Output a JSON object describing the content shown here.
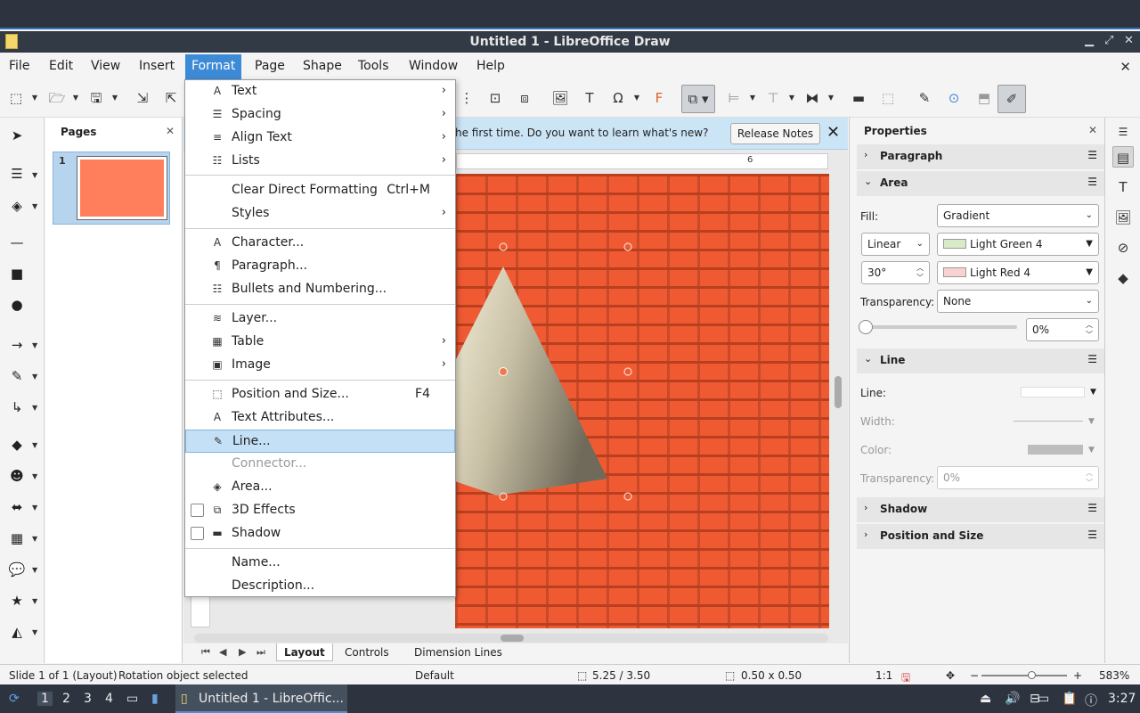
{
  "window": {
    "title": "Untitled 1 - LibreOffice Draw"
  },
  "menubar": {
    "items": [
      "File",
      "Edit",
      "View",
      "Insert",
      "Format",
      "Page",
      "Shape",
      "Tools",
      "Window",
      "Help"
    ],
    "active": "Format"
  },
  "format_menu": {
    "items": [
      {
        "label": "Text",
        "icon": "text-icon",
        "submenu": true
      },
      {
        "label": "Spacing",
        "icon": "spacing-icon",
        "submenu": true
      },
      {
        "label": "Align Text",
        "icon": "align-icon",
        "submenu": true
      },
      {
        "label": "Lists",
        "icon": "list-icon",
        "submenu": true
      },
      {
        "label": "Clear Direct Formatting",
        "shortcut": "Ctrl+M"
      },
      {
        "label": "Styles",
        "submenu": true
      },
      {
        "label": "Character...",
        "icon": "character-icon"
      },
      {
        "label": "Paragraph...",
        "icon": "paragraph-icon"
      },
      {
        "label": "Bullets and Numbering...",
        "icon": "bullets-icon"
      },
      {
        "label": "Layer...",
        "icon": "layer-icon"
      },
      {
        "label": "Table",
        "icon": "table-icon",
        "submenu": true
      },
      {
        "label": "Image",
        "icon": "image-icon",
        "submenu": true
      },
      {
        "label": "Position and Size...",
        "icon": "position-size-icon",
        "shortcut": "F4"
      },
      {
        "label": "Text Attributes...",
        "icon": "text-attributes-icon"
      },
      {
        "label": "Line...",
        "icon": "line-icon",
        "highlighted": true
      },
      {
        "label": "Connector...",
        "icon": "connector-icon",
        "disabled": true
      },
      {
        "label": "Area...",
        "icon": "area-icon"
      },
      {
        "label": "3D Effects",
        "icon": "3d-effects-icon",
        "checkbox": true
      },
      {
        "label": "Shadow",
        "icon": "shadow-icon",
        "checkbox": true
      },
      {
        "label": "Name..."
      },
      {
        "label": "Description..."
      }
    ]
  },
  "pages_panel": {
    "title": "Pages",
    "page_number": "1"
  },
  "infobar": {
    "message": "he first time. Do you want to learn what's new?",
    "button": "Release Notes"
  },
  "ruler": {
    "label": "6"
  },
  "tabs": {
    "items": [
      "Layout",
      "Controls",
      "Dimension Lines"
    ],
    "active": "Layout"
  },
  "sidebar": {
    "title": "Properties",
    "paragraph": "Paragraph",
    "area": "Area",
    "fill_label": "Fill:",
    "fill_value": "Gradient",
    "gradient_type": "Linear",
    "color_from": "Light Green 4",
    "color_from_hex": "#d7ebc9",
    "angle": "30°",
    "color_to": "Light Red 4",
    "color_to_hex": "#f8d1d1",
    "transparency_label": "Transparency:",
    "transparency_value": "None",
    "transparency_percent": "0%",
    "line": "Line",
    "line_label": "Line:",
    "width_label": "Width:",
    "color_label": "Color:",
    "line_transparency_label": "Transparency:",
    "line_transparency_value": "0%",
    "shadow": "Shadow",
    "position_size": "Position and Size"
  },
  "status": {
    "slide": "Slide 1 of 1 (Layout)",
    "selection": "Rotation object selected",
    "style": "Default",
    "position": "5.25 / 3.50",
    "size": "0.50 x 0.50",
    "scale": "1:1",
    "zoom": "583%"
  },
  "taskbar": {
    "workspaces": [
      "1",
      "2",
      "3",
      "4"
    ],
    "task": "Untitled 1 - LibreOffic...",
    "time": "3:27"
  },
  "colors": {
    "accent": "#3d8bd6",
    "brick": "#f05a33",
    "page_thumb": "#ff7f5c"
  }
}
